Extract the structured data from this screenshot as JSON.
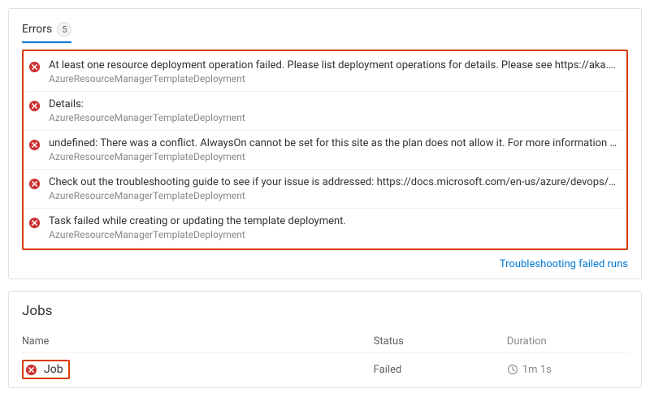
{
  "errors_panel": {
    "tab_label": "Errors",
    "count": "5",
    "troubleshoot_link": "Troubleshooting failed runs",
    "items": [
      {
        "message": "At least one resource deployment operation failed. Please list deployment operations for details. Please see https://aka.ms/DeployOper...",
        "source": "AzureResourceManagerTemplateDeployment"
      },
      {
        "message": "Details:",
        "source": "AzureResourceManagerTemplateDeployment"
      },
      {
        "message": "undefined: There was a conflict. AlwaysOn cannot be set for this site as the plan does not allow it. For more information on pricing and f...",
        "source": "AzureResourceManagerTemplateDeployment"
      },
      {
        "message": "Check out the troubleshooting guide to see if your issue is addressed: https://docs.microsoft.com/en-us/azure/devops/pipelines/tasks/...",
        "source": "AzureResourceManagerTemplateDeployment"
      },
      {
        "message": "Task failed while creating or updating the template deployment.",
        "source": "AzureResourceManagerTemplateDeployment"
      }
    ]
  },
  "jobs_panel": {
    "title": "Jobs",
    "headers": {
      "name": "Name",
      "status": "Status",
      "duration": "Duration"
    },
    "row": {
      "name": "Job",
      "status": "Failed",
      "duration": "1m 1s"
    }
  }
}
